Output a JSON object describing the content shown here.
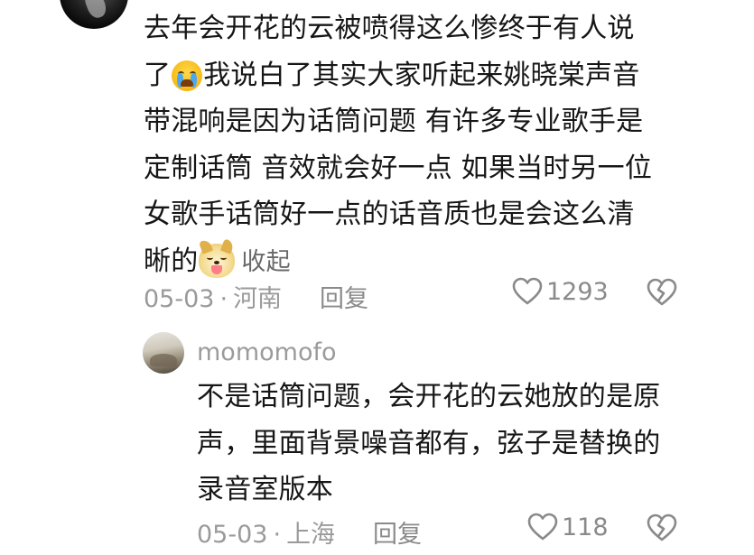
{
  "comment": {
    "lines": [
      "去年会开花的云被喷得这么惨终于有人说",
      "了",
      "我说白了其实大家听起来姚晓棠声音",
      "带混响是因为话筒问题 有许多专业歌手是",
      "定制话筒 音效就会好一点 如果当时另一位",
      "女歌手话筒好一点的话音质也是会这么清",
      "晰的"
    ],
    "emoji_1": "crying-emoji",
    "emoji_2": "dog-emoji",
    "collapse_label": "收起",
    "date": "05-03",
    "dot": "·",
    "location": "河南",
    "reply_label": "回复",
    "likes": "1293"
  },
  "reply": {
    "username": "momomofo",
    "lines": [
      "不是话筒问题，会开花的云她放的是原",
      "声，里面背景噪音都有，弦子是替换的",
      "录音室版本"
    ],
    "date": "05-03",
    "dot": "·",
    "location": "上海",
    "reply_label": "回复",
    "likes": "118"
  },
  "icons": {
    "like": "heart-outline-icon",
    "dislike": "broken-heart-icon"
  },
  "colors": {
    "text": "#161616",
    "meta": "#9a9a9a",
    "icon": "#8a8a8a"
  }
}
